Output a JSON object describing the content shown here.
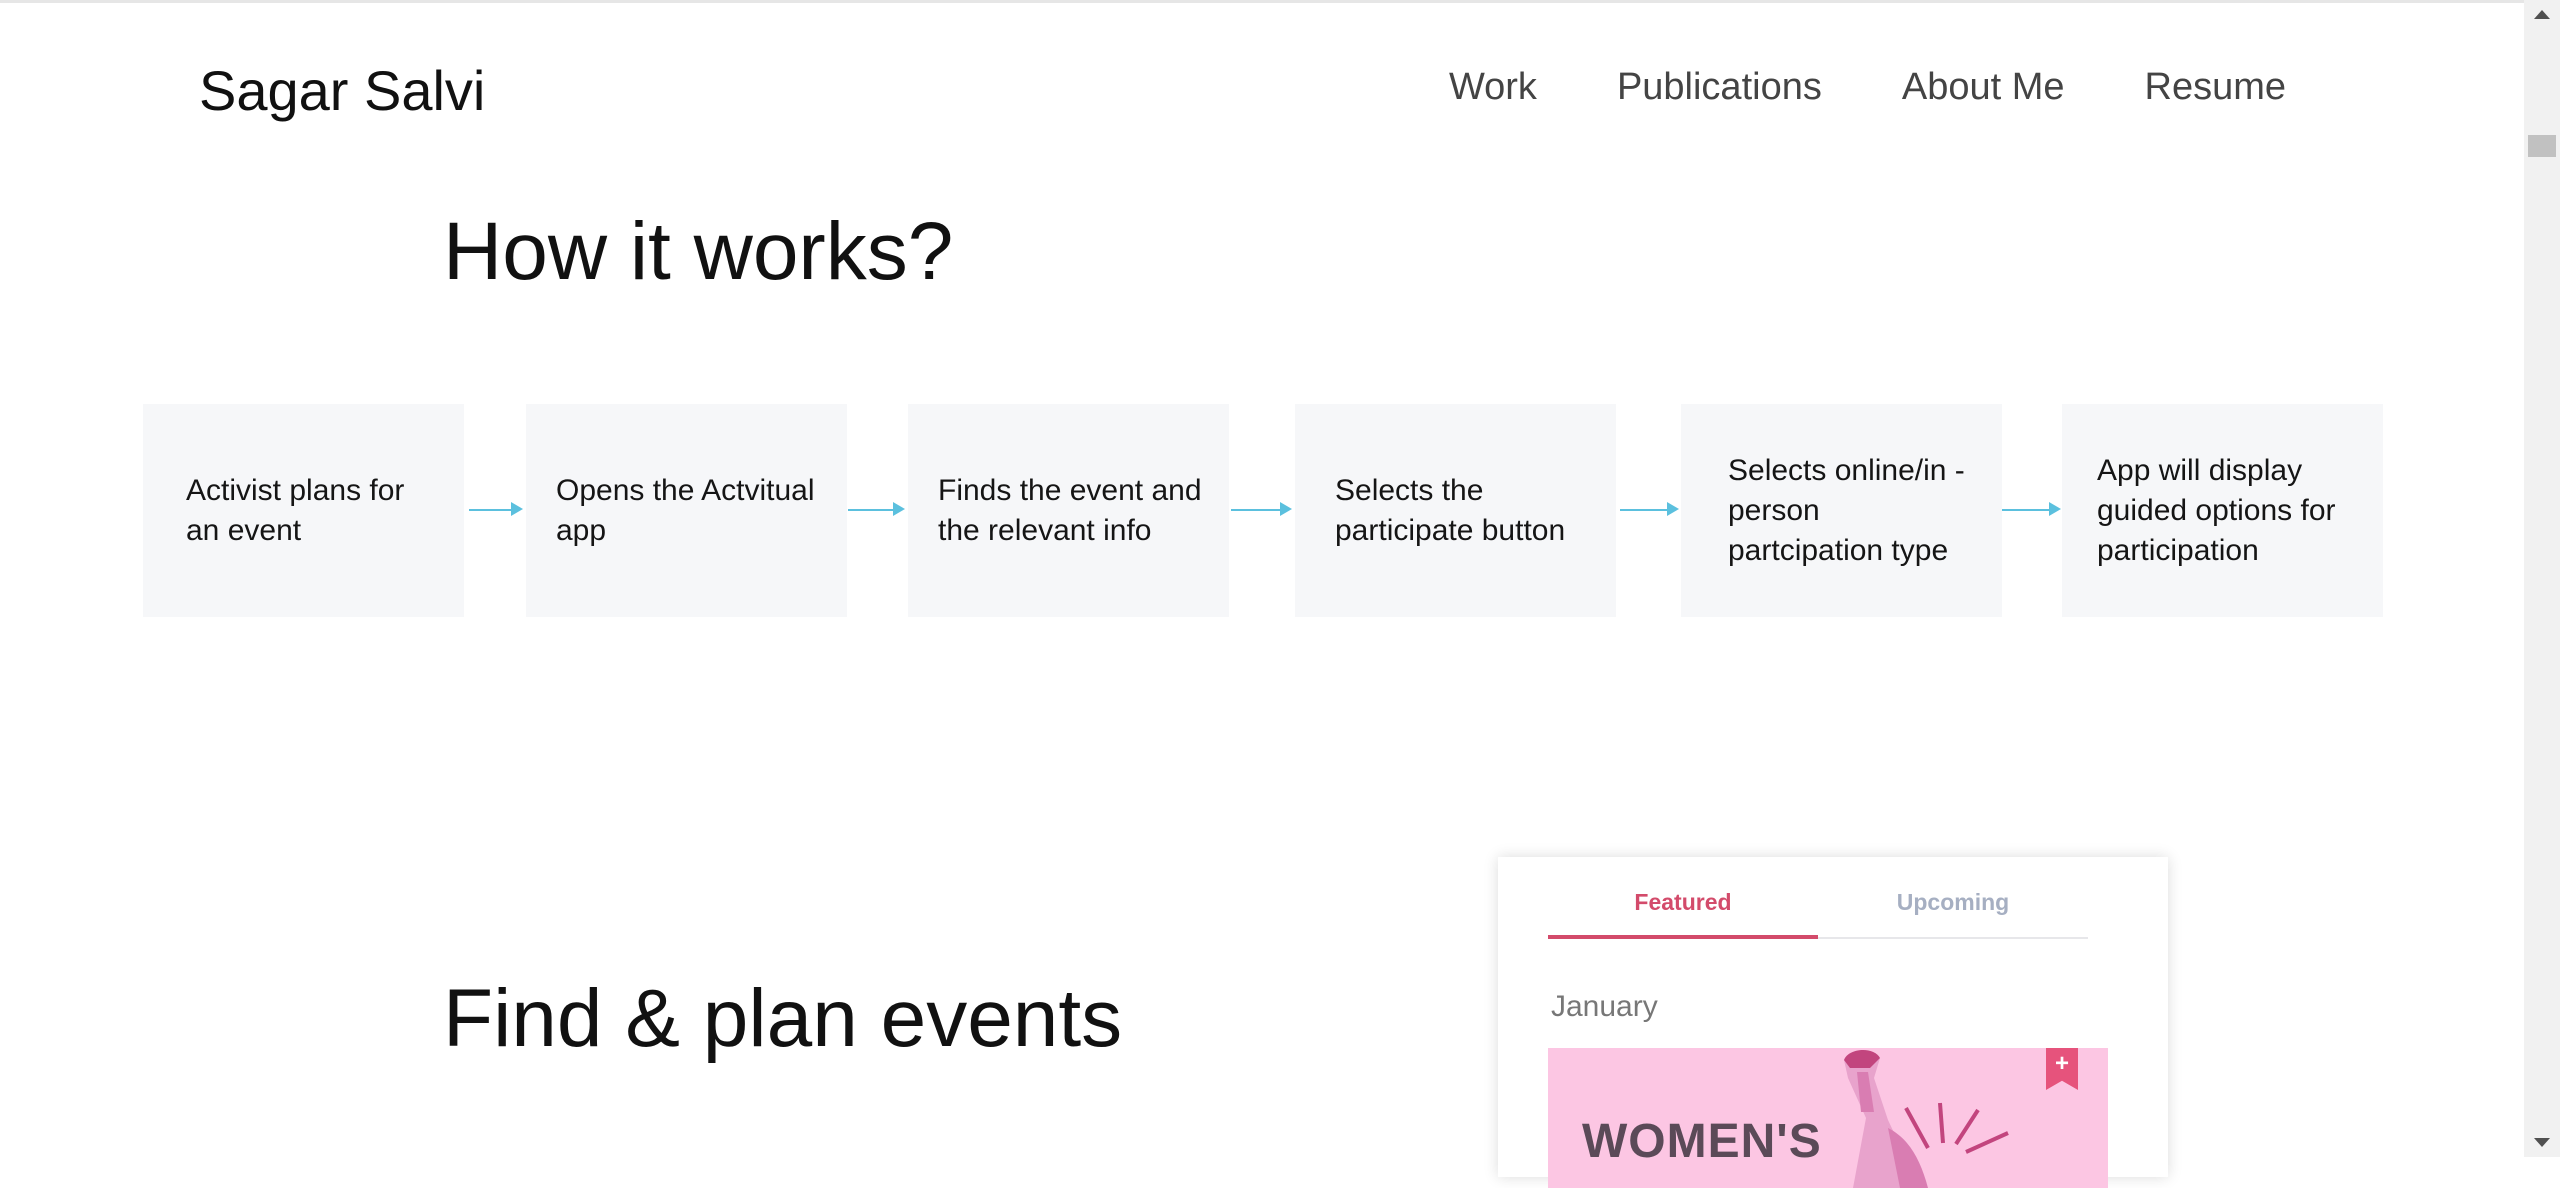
{
  "header": {
    "brand": "Sagar Salvi",
    "nav": [
      "Work",
      "Publications",
      "About Me",
      "Resume"
    ]
  },
  "how_it_works": {
    "title": "How it works?",
    "steps": [
      "Activist plans for an event",
      "Opens the Actvitual app",
      "Finds the event and the relevant info",
      "Selects the participate button",
      "Selects online/in -person partcipation type",
      "App will display guided options for participation"
    ]
  },
  "find_events": {
    "title": "Find & plan events"
  },
  "app_card": {
    "tabs": [
      "Featured",
      "Upcoming"
    ],
    "active_tab": "Featured",
    "month": "January",
    "banner_text": "WOMEN'S",
    "bookmark_symbol": "+",
    "colors": {
      "accent": "#d34b6b",
      "inactive_tab": "#a6afc2",
      "banner_bg": "#fcc6e3",
      "banner_art": "#c2457e"
    }
  },
  "colors": {
    "flow_box": "#f6f7f9",
    "arrow": "#5bc0de"
  }
}
